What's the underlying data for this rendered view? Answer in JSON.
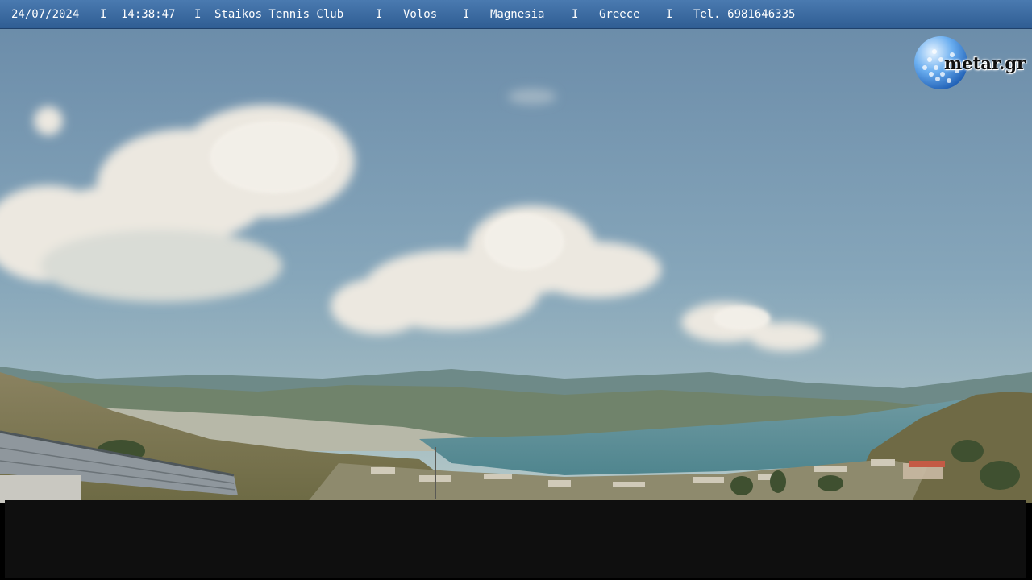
{
  "header": {
    "date": "24/07/2024",
    "time": "14:38:47",
    "club": "Staikos Tennis Club",
    "city": "Volos",
    "region": "Magnesia",
    "country": "Greece",
    "phone": "Tel. 6981646335",
    "separator": "I"
  },
  "logo": {
    "text": "metar.gr"
  },
  "colors": {
    "header_bar": "#3a68a0",
    "sky_top": "#6f90ad",
    "sky_horizon": "#a9c0c3",
    "sea": "#5d8f98",
    "overlay_box": "#0f0f0f"
  }
}
